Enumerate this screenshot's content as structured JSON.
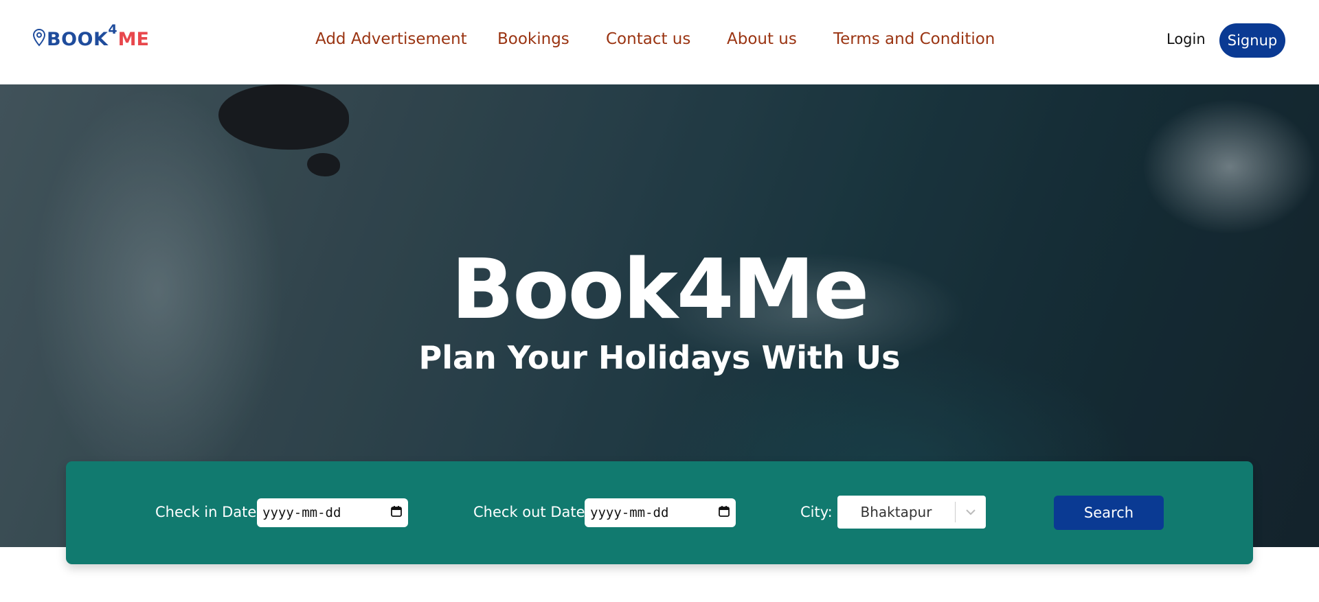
{
  "header": {
    "logo": {
      "text_book": "BOOK",
      "text_four": "4",
      "text_me": "ME",
      "icon": "map-pin-icon",
      "colors": {
        "book": "#1f4c9c",
        "me": "#e8484d"
      }
    },
    "nav": [
      {
        "label": "Add Advertisement"
      },
      {
        "label": "Bookings"
      },
      {
        "label": "Contact us"
      },
      {
        "label": "About us"
      },
      {
        "label": "Terms and Condition"
      }
    ],
    "login_label": "Login",
    "signup_label": "Signup"
  },
  "hero": {
    "title": "Book4Me",
    "subtitle": "Plan Your Holidays With Us"
  },
  "search": {
    "checkin_label": "Check in Date:",
    "checkin_value": "yyyy-mm-dd",
    "checkout_label": "Check out Date:",
    "checkout_value": "yyyy-mm-dd",
    "city_label": "City:",
    "city_value": "Bhaktapur",
    "search_label": "Search",
    "icons": {
      "date": "calendar-icon",
      "select": "chevron-down-icon"
    }
  },
  "colors": {
    "nav_text": "#9a3412",
    "primary_blue": "#0a3a93",
    "search_panel": "#117a6f"
  }
}
